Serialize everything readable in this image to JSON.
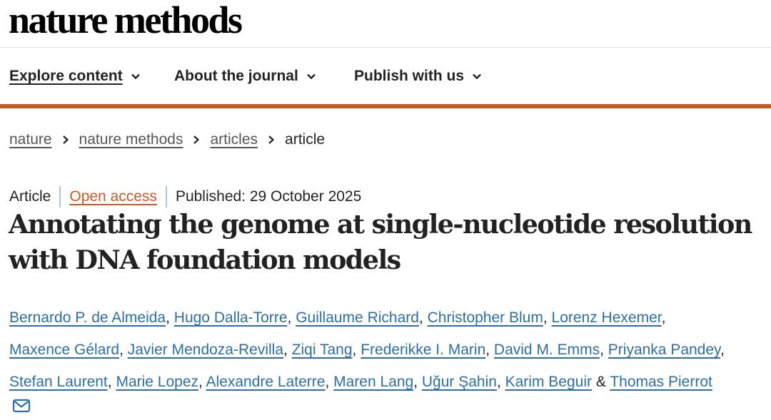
{
  "site": {
    "logo_text": "nature methods"
  },
  "nav": {
    "items": [
      {
        "label": "Explore content",
        "active": true
      },
      {
        "label": "About the journal",
        "active": false
      },
      {
        "label": "Publish with us",
        "active": false
      }
    ]
  },
  "colors": {
    "accent": "#c65a25",
    "link": "#2e6ea6",
    "divider": "#a9c7e0",
    "text": "#222222"
  },
  "breadcrumb": {
    "items": [
      "nature",
      "nature methods",
      "articles"
    ],
    "current": "article"
  },
  "article": {
    "type": "Article",
    "access": "Open access",
    "published": "Published: 29 October 2025",
    "title_line1": "Annotating the genome at single-nucleotide resolution",
    "title_line2": "with DNA foundation models",
    "authors": [
      "Bernardo P. de Almeida",
      "Hugo Dalla-Torre",
      "Guillaume Richard",
      "Christopher Blum",
      "Lorenz Hexemer",
      "Maxence Gélard",
      "Javier Mendoza-Revilla",
      "Ziqi Tang",
      "Frederikke I. Marin",
      "David M. Emms",
      "Priyanka Pandey",
      "Stefan Laurent",
      "Marie Lopez",
      "Alexandre Laterre",
      "Maren Lang",
      "Uğur Şahin",
      "Karim Beguir",
      "Thomas Pierrot"
    ],
    "author_separator": ", ",
    "author_last_joiner": " & "
  },
  "icons": {
    "chevron": "chevron-down-icon",
    "crumb_sep": "chevron-right-icon",
    "email": "mail-icon"
  }
}
